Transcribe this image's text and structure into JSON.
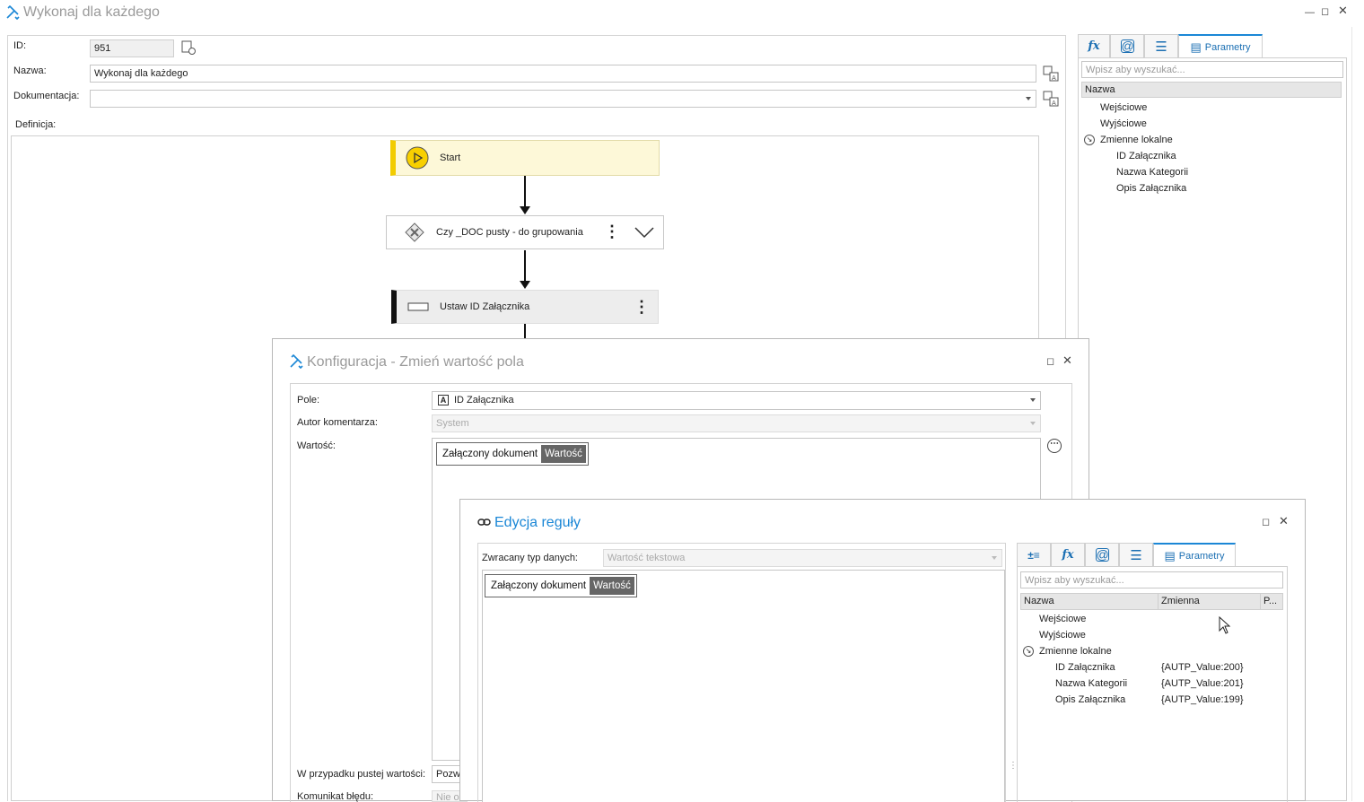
{
  "main_window": {
    "title": "Wykonaj dla każdego",
    "id_label": "ID:",
    "id_value": "951",
    "name_label": "Nazwa:",
    "name_value": "Wykonaj dla każdego",
    "doc_label": "Dokumentacja:",
    "doc_value": "",
    "definition_label": "Definicja:"
  },
  "flow": {
    "start": "Start",
    "cond": "Czy _DOC pusty - do grupowania",
    "set": "Ustaw ID Załącznika"
  },
  "right_panel": {
    "active_tab": "Parametry",
    "search_placeholder": "Wpisz aby wyszukać...",
    "header": "Nazwa",
    "items": [
      "Wejściowe",
      "Wyjściowe",
      "Zmienne lokalne",
      "ID Załącznika",
      "Nazwa Kategorii",
      "Opis Załącznika"
    ]
  },
  "config_dialog": {
    "title": "Konfiguracja - Zmień wartość pola",
    "field_label": "Pole:",
    "field_value": "ID Załącznika",
    "field_type_glyph": "A",
    "author_label": "Autor komentarza:",
    "author_value": "System",
    "value_label": "Wartość:",
    "chip_text": "Załączony dokument",
    "chip_tag": "Wartość",
    "empty_label": "W przypadku pustej wartości:",
    "empty_value": "Pozwa",
    "error_label": "Komunikat błędu:",
    "error_value": "Nie o"
  },
  "rule_dialog": {
    "title": "Edycja reguły",
    "return_type_label": "Zwracany typ danych:",
    "return_type_value": "Wartość tekstowa",
    "chip_text": "Załączony dokument",
    "chip_tag": "Wartość",
    "active_tab": "Parametry",
    "search_placeholder": "Wpisz aby wyszukać...",
    "col_name": "Nazwa",
    "col_var": "Zmienna",
    "col_p": "P...",
    "rows": [
      {
        "name": "Wejściowe",
        "var": ""
      },
      {
        "name": "Wyjściowe",
        "var": ""
      },
      {
        "name": "Zmienne lokalne",
        "var": ""
      },
      {
        "name": "ID Załącznika",
        "var": "{AUTP_Value:200}"
      },
      {
        "name": "Nazwa Kategorii",
        "var": "{AUTP_Value:201}"
      },
      {
        "name": "Opis Załącznika",
        "var": "{AUTP_Value:199}"
      }
    ]
  },
  "colors": {
    "accent": "#1b87d6",
    "start_fill": "#fdf8d8",
    "start_bar": "#f2cc00",
    "chip_tag": "#666666"
  }
}
